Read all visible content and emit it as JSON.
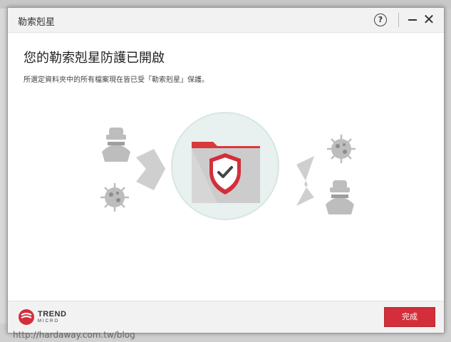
{
  "window": {
    "title": "勒索剋星"
  },
  "titlebar": {
    "help_label": "?",
    "close_label": "✕"
  },
  "main": {
    "heading": "您的勒索剋星防護已開啟",
    "description": "所選定資料夾中的所有檔案現在皆已受「勒索剋星」保護。"
  },
  "footer": {
    "logo_line1": "TREND",
    "logo_line2": "MICRO",
    "done_label": "完成"
  },
  "watermark": "http://hardaway.com.tw/blog",
  "colors": {
    "brand_red": "#d32f3a",
    "threat_gray": "#bdbdbd"
  }
}
